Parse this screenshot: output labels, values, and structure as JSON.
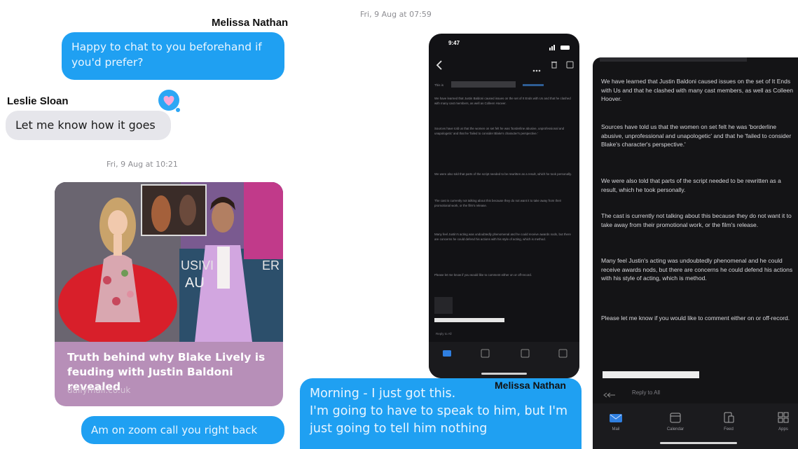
{
  "left_chat": {
    "sender_top": "Melissa Nathan",
    "bubble1": "Happy to chat to you beforehand if you'd prefer?",
    "sender_reply": "Leslie Sloan",
    "bubble2": "Let me know how it goes",
    "timestamp": "Fri, 9 Aug at 10:21",
    "link_card": {
      "title": "Truth behind why Blake Lively is feuding with Justin Baldoni revealed",
      "domain": "dailymail.co.uk",
      "image_sign_left": "USIVI",
      "image_sign_left2": "AU",
      "image_sign_right": "ER"
    },
    "bubble3": "Am on zoom call you right back"
  },
  "right_chat": {
    "timestamp": "Fri, 9 Aug at 07:59",
    "sender": "Melissa Nathan",
    "bubble": "Morning - I just got this.\nI'm going to have to speak to him, but I'm just going to tell him nothing"
  },
  "phone": {
    "time": "9:47",
    "greeting": "This is",
    "paragraphs": [
      "We have learned that Justin Baldoni caused issues on the set of It Ends with Us and that he clashed with many cast members, as well as Colleen Hoover.",
      "Sources have told us that the women on set felt he was 'borderline abusive, unprofessional and unapologetic' and that he 'failed to consider Blake's character's perspective.'",
      "We were also told that parts of the script needed to be rewritten as a result, which he took personally.",
      "The cast is currently not talking about this because they do not want it to take away from their promotional work, or the film's release.",
      "Many feel Justin's acting was undoubtedly phenomenal and he could receive awards nods, but there are concerns he could defend his actions with his style of acting, which is method.",
      "Please let me know if you would like to comment either on or off-record."
    ],
    "reply_label": "Reply to All"
  },
  "email_zoom": {
    "paragraphs": [
      "We have learned that Justin Baldoni caused issues on the set of It Ends with Us and that he clashed with many cast members, as well as Colleen Hoover.",
      "Sources have told us that the women on set felt he was 'borderline abusive, unprofessional and unapologetic' and that he 'failed to consider Blake's character's perspective.'",
      "We were also told that parts of the script needed to be rewritten as a result, which he took personally.",
      "The cast is currently not talking about this because they do not want it to take away from their promotional work, or the film's release.",
      "Many feel Justin's acting was undoubtedly phenomenal and he could receive awards nods, but there are concerns he could defend his actions with his style of acting, which is method.",
      "Please let me know if you would like to comment either on or off-record."
    ],
    "reply_label": "Reply to All",
    "tabs": [
      "Mail",
      "Calendar",
      "Feed",
      "Apps"
    ]
  },
  "colors": {
    "imessage_blue": "#1fa0f2",
    "imessage_grey": "#e6e6eb",
    "link_card_purple": "#b78fb8",
    "outlook_dark": "#141416",
    "outlook_accent": "#2f7fe0"
  },
  "icons": [
    "heart-reaction-icon",
    "back-chevron-icon",
    "more-icon",
    "trash-icon",
    "archive-icon",
    "mail-tab-icon",
    "calendar-tab-icon",
    "feed-tab-icon",
    "apps-tab-icon",
    "reply-all-icon"
  ]
}
